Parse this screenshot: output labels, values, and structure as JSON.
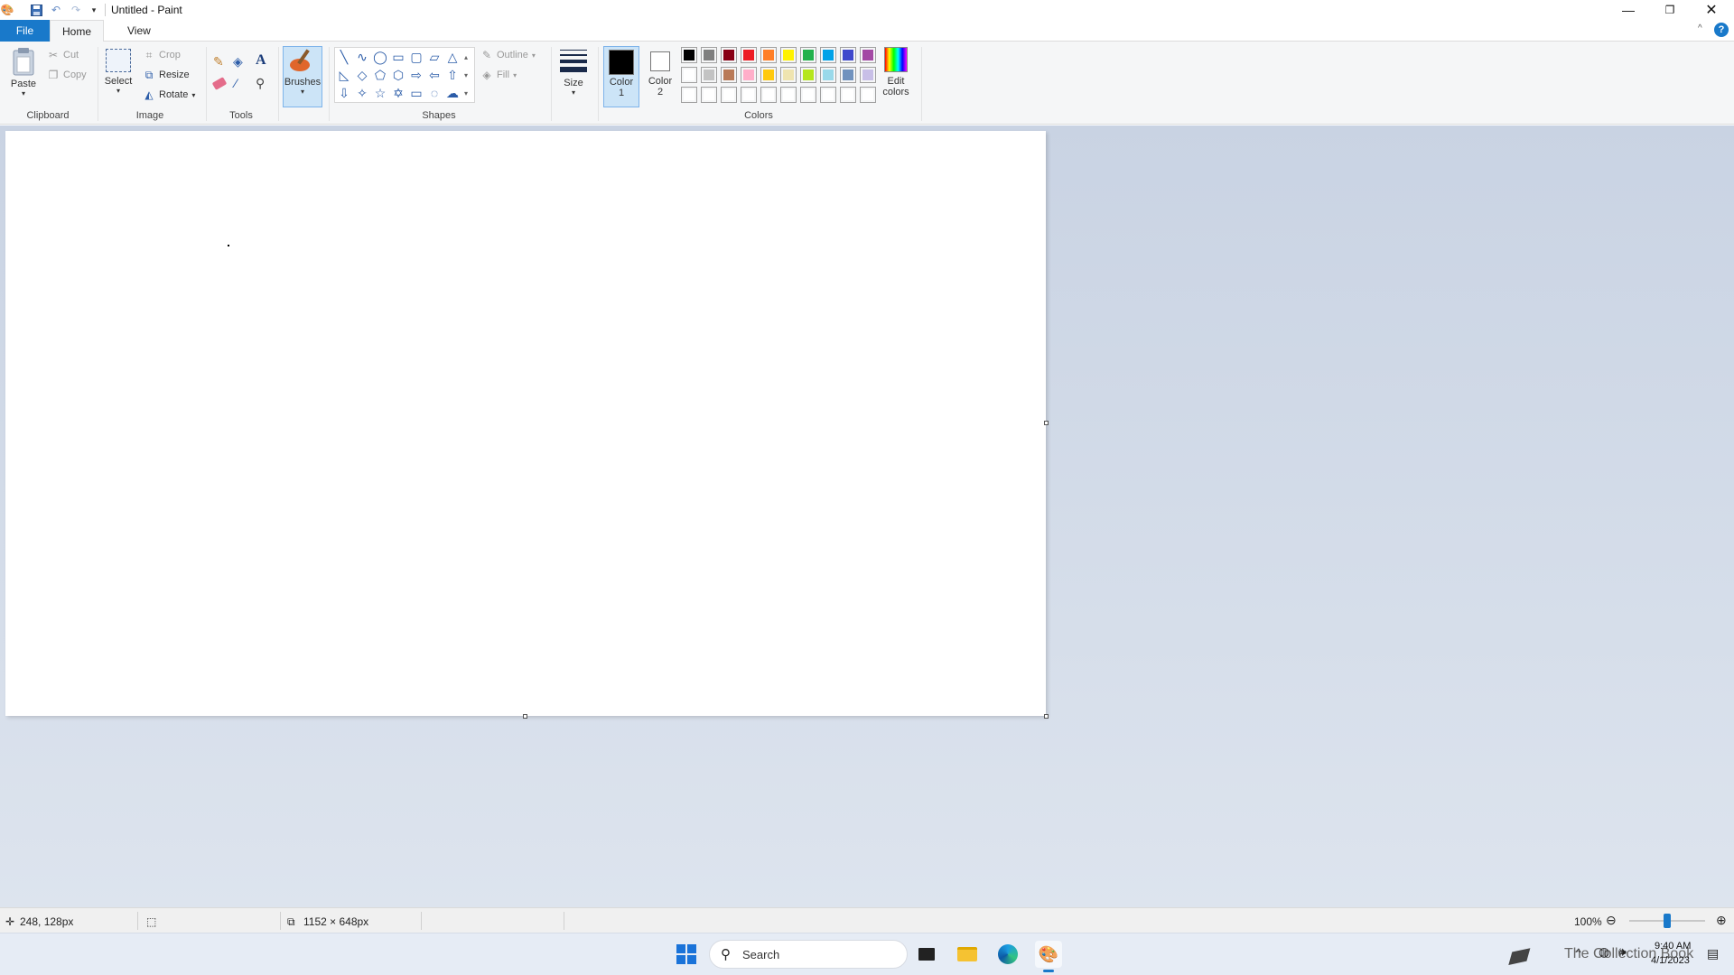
{
  "window": {
    "title": "Untitled - Paint"
  },
  "quick_access": {
    "save_icon": "save-icon",
    "undo_icon": "undo-icon",
    "redo_icon": "redo-icon"
  },
  "tabs": {
    "file": "File",
    "home": "Home",
    "view": "View"
  },
  "clipboard": {
    "paste": "Paste",
    "cut": "Cut",
    "copy": "Copy",
    "group": "Clipboard"
  },
  "image": {
    "select": "Select",
    "crop": "Crop",
    "resize": "Resize",
    "rotate": "Rotate",
    "group": "Image"
  },
  "tools": {
    "group": "Tools"
  },
  "brushes": {
    "label": "Brushes"
  },
  "shapes": {
    "outline": "Outline",
    "fill": "Fill",
    "group": "Shapes"
  },
  "size": {
    "label": "Size"
  },
  "colors": {
    "color1": "Color\n1",
    "color2": "Color\n2",
    "edit": "Edit\ncolors",
    "group": "Colors",
    "color1_value": "#000000",
    "color2_value": "#ffffff",
    "palette_row1": [
      "#000000",
      "#7f7f7f",
      "#880015",
      "#ed1c24",
      "#ff7f27",
      "#fff200",
      "#22b14c",
      "#00a2e8",
      "#3f48cc",
      "#a349a4"
    ],
    "palette_row2": [
      "#ffffff",
      "#c3c3c3",
      "#b97a57",
      "#ffaec9",
      "#ffc90e",
      "#efe4b0",
      "#b5e61d",
      "#99d9ea",
      "#7092be",
      "#c8bfe7"
    ],
    "palette_row3": [
      "#ffffff",
      "#ffffff",
      "#ffffff",
      "#ffffff",
      "#ffffff",
      "#ffffff",
      "#ffffff",
      "#ffffff",
      "#ffffff",
      "#ffffff"
    ]
  },
  "status": {
    "cursor_pos": "248, 128px",
    "canvas_size": "1152 × 648px",
    "zoom": "100%",
    "zoom_level": 0.5
  },
  "taskbar": {
    "search_placeholder": "Search",
    "time": "9:40 AM",
    "date": "4/1/2023",
    "widget_text": "The Collection Book"
  }
}
